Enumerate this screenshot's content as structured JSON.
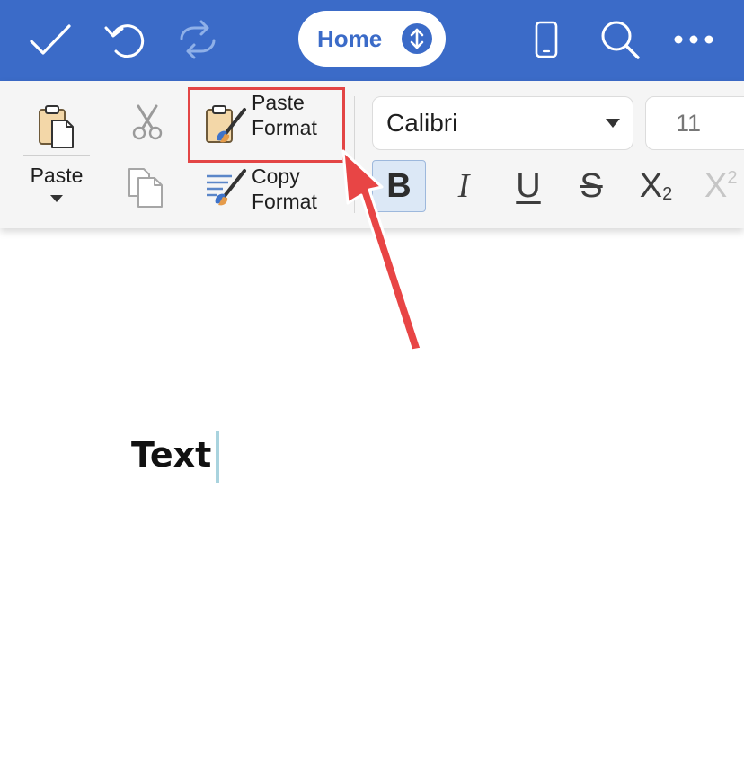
{
  "topbar": {
    "color": "#3b6bc8",
    "done_icon": "checkmark-icon",
    "undo_icon": "undo-icon",
    "redo_icon": "redo-icon",
    "tab_label": "Home",
    "tab_toggle_icon": "up-down-arrow-icon",
    "device_icon": "phone-icon",
    "search_icon": "search-icon",
    "more_icon": "ellipsis-icon"
  },
  "ribbon": {
    "paste_label": "Paste",
    "paste_icon": "clipboard-paste-icon",
    "cut_icon": "scissors-icon",
    "copy_icon": "copy-icon",
    "paste_format_line1": "Paste",
    "paste_format_line2": "Format",
    "copy_format_line1": "Copy",
    "copy_format_line2": "Format",
    "font_name": "Calibri",
    "font_size": "11",
    "bold_label": "B",
    "italic_label": "I",
    "underline_label": "U",
    "strike_label": "S",
    "subscript_label": "X",
    "subscript_mark": "2",
    "superscript_label": "X",
    "superscript_mark": "2",
    "highlight_color": "#e34545"
  },
  "document": {
    "text": "Text"
  }
}
